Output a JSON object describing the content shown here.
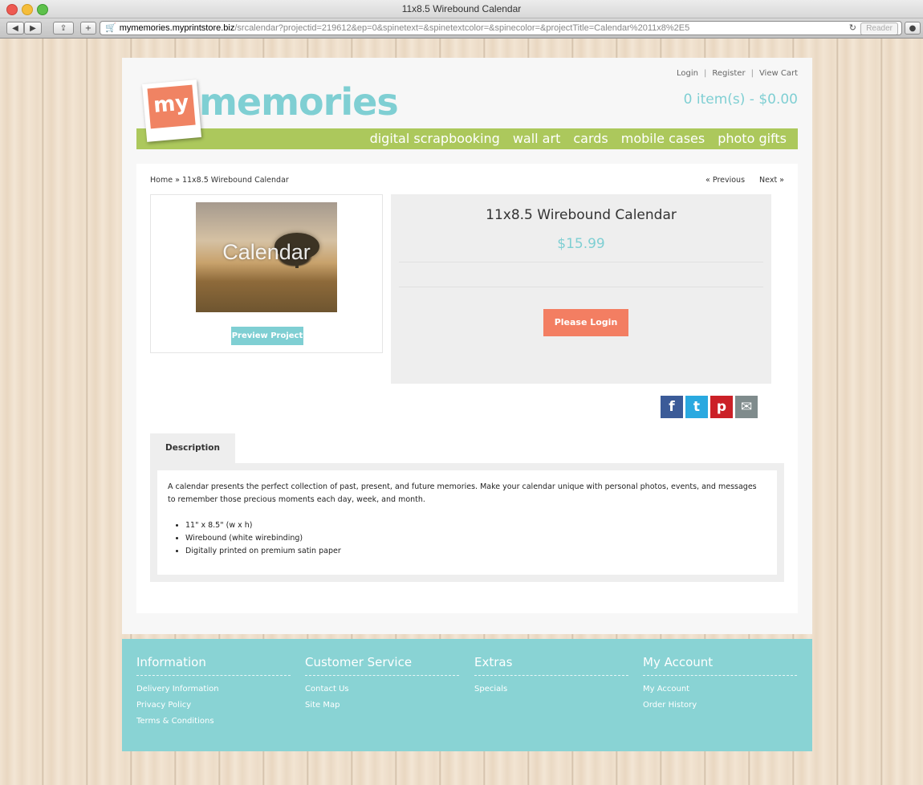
{
  "window": {
    "title": "11x8.5 Wirebound Calendar"
  },
  "toolbar": {
    "back_icon": "back-arrow-icon",
    "forward_icon": "forward-arrow-icon",
    "url_host": "mymemories.myprintstore.biz",
    "url_path": "/srcalendar?projectid=219612&ep=0&spinetext=&spinetextcolor=&spinecolor=&projectTitle=Calendar%2011x8%2E5",
    "reader_label": "Reader"
  },
  "header": {
    "links": {
      "login": "Login",
      "register": "Register",
      "view_cart": "View Cart"
    },
    "cart_summary": "0 item(s) - $0.00",
    "logo_badge": "my",
    "logo_word": "memories"
  },
  "nav": [
    "digital scrapbooking",
    "wall art",
    "cards",
    "mobile cases",
    "photo gifts"
  ],
  "breadcrumb": {
    "home": "Home",
    "sep": "»",
    "current": "11x8.5 Wirebound Calendar"
  },
  "pager": {
    "previous": "« Previous",
    "next": "Next »"
  },
  "product": {
    "image_text": "Calendar",
    "preview_label": "Preview Project",
    "title": "11x8.5 Wirebound Calendar",
    "price": "$15.99",
    "login_label": "Please Login"
  },
  "share": {
    "facebook": "f",
    "twitter": "t",
    "pinterest": "p",
    "email": "✉"
  },
  "tabs": {
    "description": "Description"
  },
  "description": {
    "text": "A calendar presents the perfect collection of past, present, and future memories. Make your calendar unique with personal photos, events, and messages to remember those precious moments each day, week, and month.",
    "bullets": [
      "11\" x 8.5\" (w x h)",
      "Wirebound (white wirebinding)",
      "Digitally printed on premium satin paper"
    ]
  },
  "footer": {
    "information": {
      "heading": "Information",
      "links": [
        "Delivery Information",
        "Privacy Policy",
        "Terms & Conditions"
      ]
    },
    "customer_service": {
      "heading": "Customer Service",
      "links": [
        "Contact Us",
        "Site Map"
      ]
    },
    "extras": {
      "heading": "Extras",
      "links": [
        "Specials"
      ]
    },
    "my_account": {
      "heading": "My Account",
      "links": [
        "My Account",
        "Order History"
      ]
    }
  },
  "colors": {
    "accent_teal": "#7fcfd3",
    "nav_green": "#acc85c",
    "button_coral": "#f37e62",
    "footer_teal": "#89d3d4"
  }
}
